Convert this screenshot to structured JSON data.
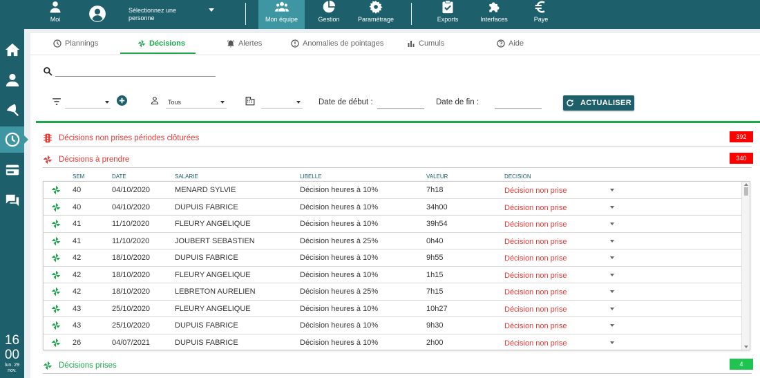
{
  "topbar": {
    "moi_label": "Moi",
    "person_select": "Sélectionnez une personne",
    "mon_equipe_label": "Mon équipe",
    "gestion_label": "Gestion",
    "parametrage_label": "Paramétrage",
    "exports_label": "Exports",
    "interfaces_label": "Interfaces",
    "paye_label": "Paye"
  },
  "clock": {
    "hours": "16",
    "minutes": "00",
    "date_line1": "lun. 29",
    "date_line2": "nov."
  },
  "tabs": [
    {
      "label": "Plannings",
      "icon": "clock-icon"
    },
    {
      "label": "Décisions",
      "icon": "pinwheel-icon"
    },
    {
      "label": "Alertes",
      "icon": "alarm-icon"
    },
    {
      "label": "Anomalies de pointages",
      "icon": "warning-circle-icon"
    },
    {
      "label": "Cumuls",
      "icon": "bar-chart-icon"
    },
    {
      "label": "Aide",
      "icon": "help-icon"
    }
  ],
  "filters": {
    "employee_select": "Tous",
    "start_date_label": "Date de début :",
    "end_date_label": "Date de fin :",
    "refresh_button": "ACTUALISER"
  },
  "sections": {
    "closed": {
      "title": "Décisions non prises périodes clôturées",
      "count": "392"
    },
    "to_take": {
      "title": "Décisions à prendre",
      "count": "340"
    },
    "taken": {
      "title": "Décisions prises",
      "count": "4"
    }
  },
  "columns": [
    "SEM",
    "DATE",
    "SALARIE",
    "LIBELLE",
    "VALEUR",
    "DECISION"
  ],
  "rows": [
    {
      "sem": "40",
      "date": "04/10/2020",
      "salarie": "MENARD SYLVIE",
      "libelle": "Décision heures à 10%",
      "valeur": "7h18",
      "decision": "Décision non prise"
    },
    {
      "sem": "40",
      "date": "04/10/2020",
      "salarie": "DUPUIS FABRICE",
      "libelle": "Décision heures à 10%",
      "valeur": "34h00",
      "decision": "Décision non prise"
    },
    {
      "sem": "41",
      "date": "11/10/2020",
      "salarie": "FLEURY ANGELIQUE",
      "libelle": "Décision heures à 10%",
      "valeur": "39h54",
      "decision": "Décision non prise"
    },
    {
      "sem": "41",
      "date": "11/10/2020",
      "salarie": "JOUBERT SEBASTIEN",
      "libelle": "Décision heures à 25%",
      "valeur": "0h40",
      "decision": "Décision non prise"
    },
    {
      "sem": "42",
      "date": "18/10/2020",
      "salarie": "DUPUIS FABRICE",
      "libelle": "Décision heures à 10%",
      "valeur": "9h55",
      "decision": "Décision non prise"
    },
    {
      "sem": "42",
      "date": "18/10/2020",
      "salarie": "FLEURY ANGELIQUE",
      "libelle": "Décision heures à 10%",
      "valeur": "1h15",
      "decision": "Décision non prise"
    },
    {
      "sem": "42",
      "date": "18/10/2020",
      "salarie": "LEBRETON AURELIEN",
      "libelle": "Décision heures à 25%",
      "valeur": "7h15",
      "decision": "Décision non prise"
    },
    {
      "sem": "43",
      "date": "25/10/2020",
      "salarie": "FLEURY ANGELIQUE",
      "libelle": "Décision heures à 10%",
      "valeur": "10h27",
      "decision": "Décision non prise"
    },
    {
      "sem": "43",
      "date": "25/10/2020",
      "salarie": "DUPUIS FABRICE",
      "libelle": "Décision heures à 10%",
      "valeur": "9h30",
      "decision": "Décision non prise"
    },
    {
      "sem": "26",
      "date": "04/07/2021",
      "salarie": "DUPUIS FABRICE",
      "libelle": "Décision heures à 10%",
      "valeur": "2h00",
      "decision": "Décision non prise"
    }
  ],
  "colors": {
    "primary": "#1d5f6b",
    "active": "#3d96a2",
    "green": "#1aa84b",
    "red": "#e53935",
    "badge_red": "#ff0000"
  }
}
